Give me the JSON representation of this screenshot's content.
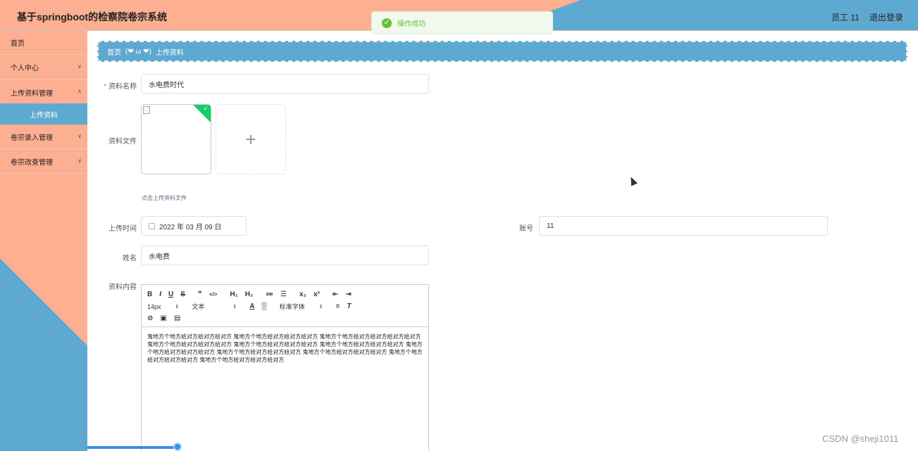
{
  "header": {
    "title": "基于springboot的检察院卷宗系统",
    "user": "员工 11",
    "logout": "退出登录"
  },
  "toast": {
    "text": "操作成功",
    "icon": "check-circle-icon"
  },
  "sidebar": {
    "items": [
      {
        "label": "首页"
      },
      {
        "label": "个人中心"
      },
      {
        "label": "上传资料管理"
      },
      {
        "label": "卷宗录入管理"
      },
      {
        "label": "卷宗改查管理"
      }
    ],
    "sub_item": "上传资料"
  },
  "breadcrumb": {
    "home": "首页",
    "separator": "(❤ ω ❤)",
    "current": "上传资料"
  },
  "form": {
    "name_label": "资料名称",
    "name_value": "水电费时代",
    "file_label": "资料文件",
    "file_hint": "点击上传资料文件",
    "time_label": "上传时间",
    "time_value": "2022 年 03 月 09 日",
    "account_label": "账号",
    "account_value": "11",
    "person_label": "姓名",
    "person_value": "水电费",
    "content_label": "资料内容"
  },
  "editor": {
    "toolbar_row1": [
      "B",
      "I",
      "U",
      "S",
      "❞",
      "</>",
      "H₁",
      "H₂",
      "≔",
      "☰",
      "x₂",
      "x²",
      "⇤",
      "⇥"
    ],
    "font_size": "14px",
    "block_type": "文本",
    "font_family": "标准字体",
    "content": "鬼地方个地方给对方给对方给对方 鬼地方个地方给对方给对方给对方 鬼地方个地方给对方给对方给对方给对方 鬼地方个地方给对方给对方给对方 鬼地方个地方给对方给对方给对方 鬼地方个地方给对方给对方给对方 鬼地方个地方给对方给对方给对方 鬼地方个地方给对方给对方给对方 鬼地方个地方给对方给对方给对方 鬼地方个地方给对方给对方给对方 鬼地方个地方给对方给对方给对方"
  },
  "watermark": "CSDN @sheji1011",
  "colors": {
    "peach": "#fdaf91",
    "blue": "#5ea9d0",
    "success": "#67c23a"
  }
}
